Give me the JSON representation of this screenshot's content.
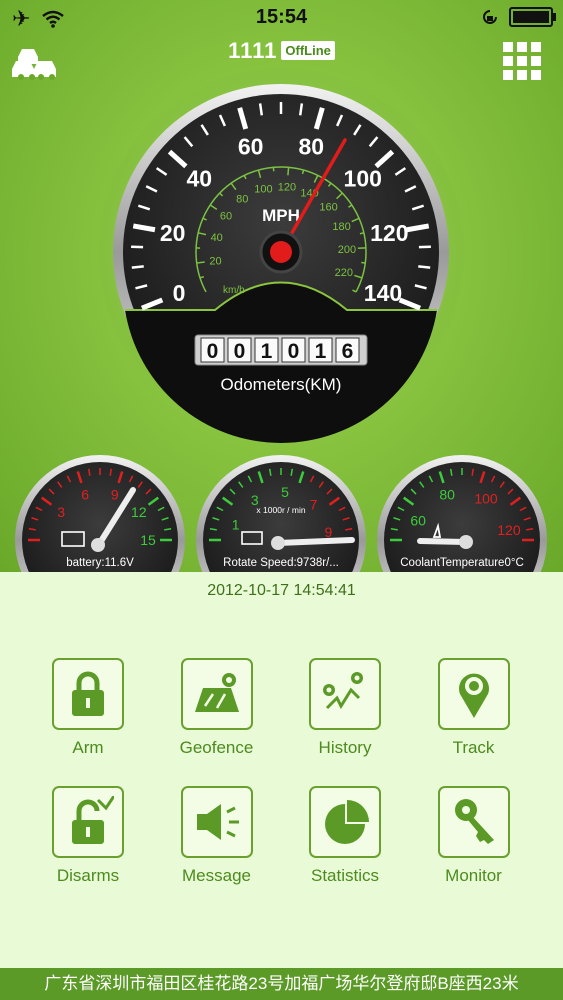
{
  "status_bar": {
    "time": "15:54"
  },
  "header": {
    "device_id": "1111",
    "status_badge": "OffLine"
  },
  "speedometer": {
    "mph_ticks": [
      "0",
      "20",
      "40",
      "60",
      "80",
      "100",
      "120",
      "140"
    ],
    "kmh_ticks": [
      "20",
      "40",
      "60",
      "80",
      "100",
      "120",
      "140",
      "160",
      "180",
      "200",
      "220"
    ],
    "unit": "MPH",
    "kmh_unit": "km/h",
    "odometer_digits": [
      "0",
      "0",
      "1",
      "0",
      "1",
      "6"
    ],
    "odometer_label": "Odometers(KM)"
  },
  "battery_gauge": {
    "ticks": [
      "3",
      "6",
      "9",
      "12",
      "15"
    ],
    "label": "battery:11.6V"
  },
  "rpm_gauge": {
    "ticks": [
      "1",
      "3",
      "5",
      "7",
      "9"
    ],
    "unit": "x 1000r / min",
    "label": "Rotate Speed:9738r/..."
  },
  "coolant_gauge": {
    "ticks": [
      "60",
      "80",
      "100",
      "120"
    ],
    "label": "CoolantTemperature0°C"
  },
  "datetime": "2012-10-17 14:54:41",
  "menu": [
    {
      "label": "Arm",
      "icon": "lock-icon"
    },
    {
      "label": "Geofence",
      "icon": "geofence-map-icon"
    },
    {
      "label": "History",
      "icon": "history-route-icon"
    },
    {
      "label": "Track",
      "icon": "track-pin-icon"
    },
    {
      "label": "Disarms",
      "icon": "unlock-icon"
    },
    {
      "label": "Message",
      "icon": "speaker-icon"
    },
    {
      "label": "Statistics",
      "icon": "pie-chart-icon"
    },
    {
      "label": "Monitor",
      "icon": "key-icon"
    }
  ],
  "footer": {
    "address": "广东省深圳市福田区桂花路23号加福广场华尔登府邸B座西23米"
  },
  "colors": {
    "green_bg": "#86c23e",
    "panel_bg": "#e9fbd6",
    "accent_green": "#4d8a1f",
    "needle_red": "#e21b1b"
  }
}
